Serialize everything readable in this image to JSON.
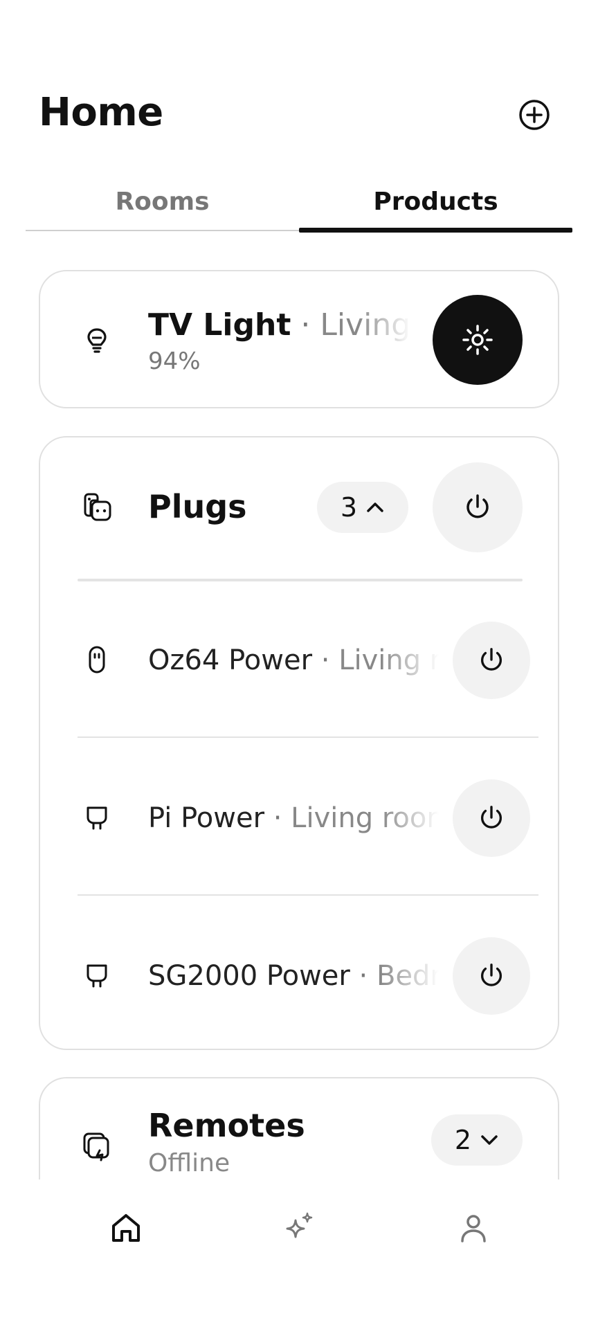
{
  "header": {
    "title": "Home",
    "add_icon": "plus-circle-icon"
  },
  "tabs": [
    {
      "label": "Rooms",
      "selected": false
    },
    {
      "label": "Products",
      "selected": true
    }
  ],
  "tv_light": {
    "name": "TV Light",
    "separator": " · ",
    "room": "Living room",
    "status": "94%",
    "icon": "bulb-icon",
    "toggle_icon": "sun-icon",
    "toggle_on": true
  },
  "plugs": {
    "title": "Plugs",
    "count": "3",
    "icon": "plug-group-icon",
    "expanded": true,
    "items": [
      {
        "name": "Oz64 Power",
        "separator": " · ",
        "room": "Living room",
        "icon": "smart-plug-icon"
      },
      {
        "name": "Pi Power",
        "separator": " · ",
        "room": "Living room",
        "icon": "plug-icon"
      },
      {
        "name": "SG2000 Power",
        "separator": " · ",
        "room": "Bedroom",
        "icon": "plug-icon"
      }
    ]
  },
  "remotes": {
    "title": "Remotes",
    "status": "Offline",
    "count": "2",
    "icon": "remote-icon",
    "expanded": false
  },
  "bottom_nav": [
    {
      "name": "home",
      "icon": "home-icon",
      "active": true
    },
    {
      "name": "ideas",
      "icon": "sparkle-icon",
      "active": false
    },
    {
      "name": "profile",
      "icon": "person-icon",
      "active": false
    }
  ],
  "colors": {
    "primary": "#111111",
    "muted_text": "#777777",
    "pill_bg": "#f2f2f2",
    "card_border": "#e0e0e0"
  }
}
